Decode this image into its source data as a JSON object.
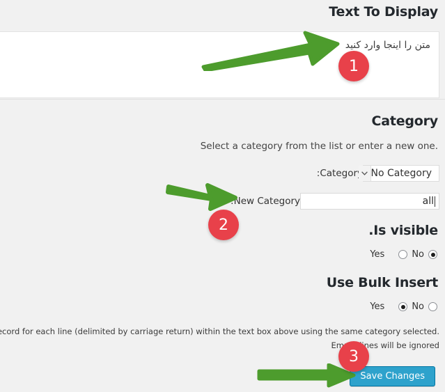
{
  "sections": {
    "text_to_display": {
      "title": "Text To Display",
      "textarea_value": "متن را اینجا وارد کنید"
    },
    "category": {
      "title": "Category",
      "help": ".Select a category from the list or enter a new one",
      "category_label": ":Category",
      "category_selected": "No Category",
      "category_options": [
        "No Category"
      ],
      "new_category_label": ":New Category",
      "new_category_value": "all"
    },
    "is_visible": {
      "title": ".Is visible",
      "yes_label": "Yes",
      "no_label": "No",
      "selected": "Yes"
    },
    "bulk_insert": {
      "title": "Use Bulk Insert",
      "yes_label": "Yes",
      "no_label": "No",
      "selected": "No",
      "help_line_1": ".Bulk insert will create a new record for each line (delimited by carriage return) within the text box above using the same category selected",
      "help_line_2": "Empty lines will be ignored"
    }
  },
  "actions": {
    "save_label": "Save Changes"
  },
  "annotations": {
    "badges": [
      {
        "number": "1"
      },
      {
        "number": "2"
      },
      {
        "number": "3"
      }
    ],
    "arrow_color": "#4d9c2d",
    "badge_color": "#e8414a"
  },
  "colors": {
    "page_background": "#f1f1f1",
    "field_background": "#ffffff",
    "button_background": "#2ea2cc",
    "button_border": "#0074a2",
    "text": "#23282d"
  }
}
